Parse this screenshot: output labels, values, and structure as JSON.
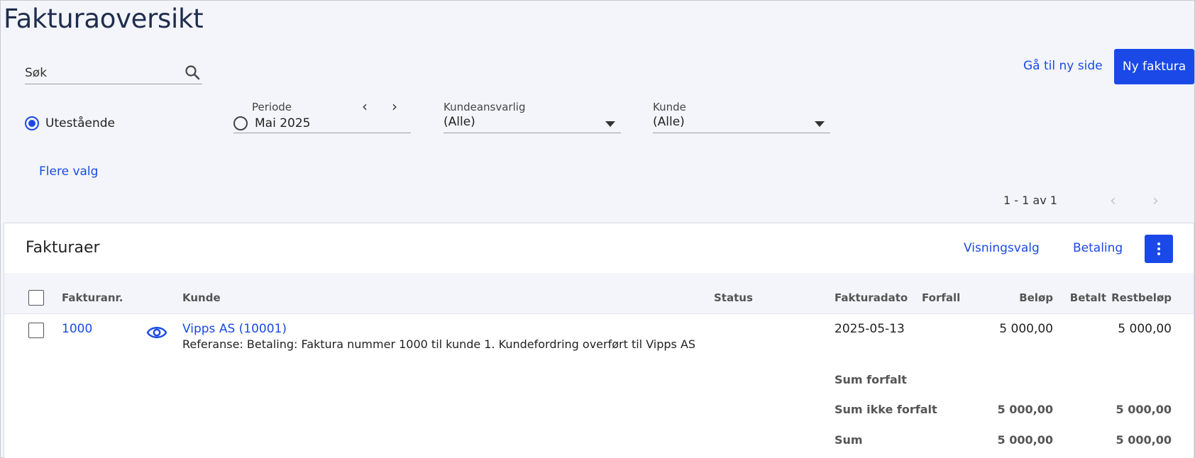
{
  "page": {
    "title": "Fakturaoversikt"
  },
  "search": {
    "placeholder": "Søk",
    "value": ""
  },
  "actions": {
    "go_new_page": "Gå til ny side",
    "new_invoice": "Ny faktura"
  },
  "filters": {
    "outstanding_label": "Utestående",
    "outstanding_selected": true,
    "period": {
      "label": "Periode",
      "value": "Mai 2025",
      "selected": false
    },
    "account_manager": {
      "label": "Kundeansvarlig",
      "value": "(Alle)"
    },
    "customer": {
      "label": "Kunde",
      "value": "(Alle)"
    },
    "more_options": "Flere valg"
  },
  "pagination": {
    "text": "1 - 1 av 1"
  },
  "card": {
    "title": "Fakturaer",
    "view_options": "Visningsvalg",
    "payment": "Betaling"
  },
  "table": {
    "columns": {
      "invoice_no": "Fakturanr.",
      "customer": "Kunde",
      "status": "Status",
      "invoice_date": "Fakturadato",
      "due": "Forfall",
      "amount": "Beløp",
      "paid": "Betalt",
      "remaining": "Restbeløp"
    },
    "rows": [
      {
        "invoice_no": "1000",
        "customer": "Vipps AS (10001)",
        "reference": "Referanse: Betaling: Faktura nummer 1000 til kunde 1. Kundefordring overført til Vipps AS",
        "status": "",
        "invoice_date": "2025-05-13",
        "due": "",
        "amount": "5 000,00",
        "paid": "",
        "remaining": "5 000,00"
      }
    ],
    "sums": [
      {
        "label": "Sum forfalt",
        "amount": "",
        "remaining": ""
      },
      {
        "label": "Sum ikke forfalt",
        "amount": "5 000,00",
        "remaining": "5 000,00"
      },
      {
        "label": "Sum",
        "amount": "5 000,00",
        "remaining": "5 000,00"
      }
    ]
  },
  "colors": {
    "accent": "#1a49e8"
  }
}
